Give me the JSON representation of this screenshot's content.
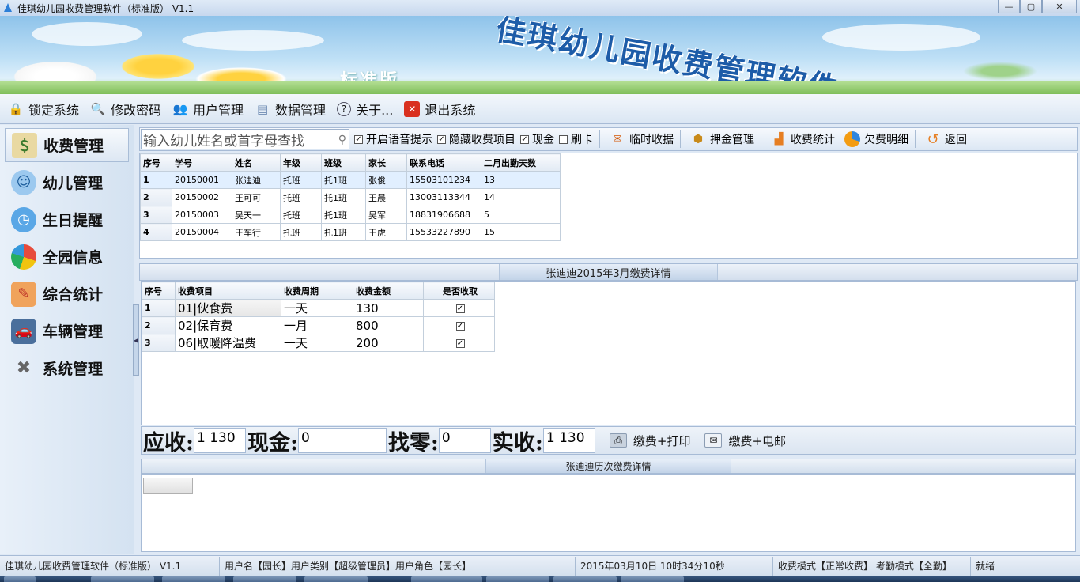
{
  "window": {
    "title": "佳琪幼儿园收费管理软件（标准版） V1.1",
    "buttons": {
      "minimize": "—",
      "maximize": "▢",
      "close": "✕"
    }
  },
  "banner": {
    "title": "佳琪幼儿园收费管理软件",
    "subtitle": "标准版"
  },
  "menu": [
    {
      "label": "锁定系统",
      "icon": "lock-icon"
    },
    {
      "label": "修改密码",
      "icon": "search-icon"
    },
    {
      "label": "用户管理",
      "icon": "user-icon"
    },
    {
      "label": "数据管理",
      "icon": "database-icon"
    },
    {
      "label": "关于...",
      "icon": "help-icon"
    },
    {
      "label": "退出系统",
      "icon": "exit-icon"
    }
  ],
  "nav": [
    {
      "label": "收费管理",
      "icon": "money-icon",
      "active": true
    },
    {
      "label": "幼儿管理",
      "icon": "children-icon",
      "active": false
    },
    {
      "label": "生日提醒",
      "icon": "clock-icon",
      "active": false
    },
    {
      "label": "全园信息",
      "icon": "pie-chart-icon",
      "active": false
    },
    {
      "label": "综合统计",
      "icon": "statistics-icon",
      "active": false
    },
    {
      "label": "车辆管理",
      "icon": "car-icon",
      "active": false
    },
    {
      "label": "系统管理",
      "icon": "tools-icon",
      "active": false
    }
  ],
  "toolbar": {
    "search_placeholder": "输入幼儿姓名或首字母查找",
    "checkboxes": [
      {
        "label": "开启语音提示",
        "checked": true
      },
      {
        "label": "隐藏收费项目",
        "checked": true
      },
      {
        "label": "现金",
        "checked": true
      },
      {
        "label": "刷卡",
        "checked": false
      }
    ],
    "buttons": [
      {
        "label": "临时收据",
        "icon": "receipt-icon"
      },
      {
        "label": "押金管理",
        "icon": "deposit-icon"
      },
      {
        "label": "收费统计",
        "icon": "bar-chart-icon"
      },
      {
        "label": "欠费明细",
        "icon": "pie-icon"
      },
      {
        "label": "返回",
        "icon": "return-icon"
      }
    ]
  },
  "students": {
    "columns": [
      "序号",
      "学号",
      "姓名",
      "年级",
      "班级",
      "家长",
      "联系电话",
      "二月出勤天数"
    ],
    "rows": [
      [
        "1",
        "20150001",
        "张迪迪",
        "托班",
        "托1班",
        "张俊",
        "15503101234",
        "13"
      ],
      [
        "2",
        "20150002",
        "王可可",
        "托班",
        "托1班",
        "王晨",
        "13003113344",
        "14"
      ],
      [
        "3",
        "20150003",
        "吴天一",
        "托班",
        "托1班",
        "吴军",
        "18831906688",
        "5"
      ],
      [
        "4",
        "20150004",
        "王车行",
        "托班",
        "托1班",
        "王虎",
        "15533227890",
        "15"
      ]
    ]
  },
  "fee_detail": {
    "caption": "张迪迪2015年3月缴费详情",
    "columns": [
      "序号",
      "收费项目",
      "收费周期",
      "收费金额",
      "是否收取"
    ],
    "rows": [
      [
        "1",
        "01|伙食费",
        "一天",
        "130",
        true
      ],
      [
        "2",
        "02|保育费",
        "一月",
        "800",
        true
      ],
      [
        "3",
        "06|取暖降温费",
        "一天",
        "200",
        true
      ]
    ]
  },
  "payment": {
    "receivable_label": "应收:",
    "receivable_value": "1 130",
    "cash_label": "现金:",
    "cash_value": "0",
    "change_label": "找零:",
    "change_value": "0",
    "received_label": "实收:",
    "received_value": "1 130",
    "pay_print_label": "缴费+打印",
    "pay_email_label": "缴费+电邮"
  },
  "history": {
    "caption": "张迪迪历次缴费详情"
  },
  "status": {
    "app": "佳琪幼儿园收费管理软件（标准版） V1.1",
    "user": "用户名【园长】用户类别【超级管理员】用户角色【园长】",
    "datetime": "2015年03月10日 10时34分10秒",
    "mode": "收费模式【正常收费】 考勤模式【全勤】",
    "state": "就绪"
  },
  "colors": {
    "accent": "#1d5ca8",
    "panel_border": "#a7bbd6",
    "selected_row": "#e1efff"
  }
}
